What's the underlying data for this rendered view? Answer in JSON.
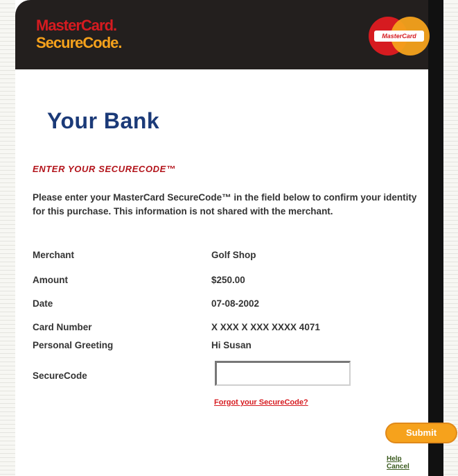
{
  "brand": {
    "line1": "MasterCard.",
    "line2": "SecureCode."
  },
  "logo": {
    "wordmark": "MasterCard"
  },
  "bank_title": "Your Bank",
  "section_head": "ENTER YOUR SECURECODE™",
  "description": "Please enter your MasterCard SecureCode™ in the field below to confirm your identity for this purchase. This information is not shared with the merchant.",
  "fields": [
    {
      "label": "Merchant",
      "value": "Golf Shop"
    },
    {
      "label": "Amount",
      "value": "$250.00"
    },
    {
      "label": "Date",
      "value": "07-08-2002"
    },
    {
      "label": "Card Number",
      "value": "X XXX X XXX XXXX 4071"
    },
    {
      "label": "Personal Greeting",
      "value": "Hi Susan"
    }
  ],
  "securecode_label": "SecureCode",
  "forgot_link": "Forgot your SecureCode?",
  "submit_label": "Submit",
  "footer_links": [
    "Help",
    "Cancel"
  ],
  "colors": {
    "brand_red": "#d61b20",
    "brand_yellow": "#f6a21c",
    "title_blue": "#1b3a78"
  }
}
